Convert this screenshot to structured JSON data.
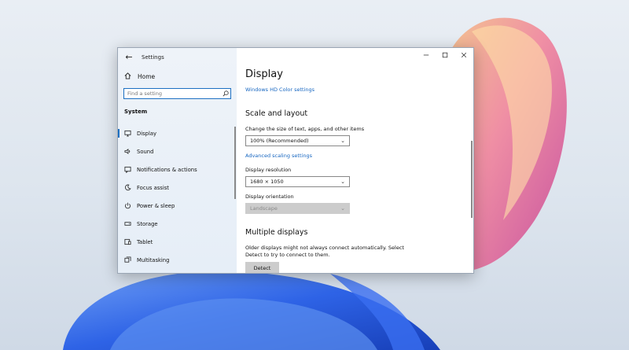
{
  "window": {
    "title": "Settings"
  },
  "sidebar": {
    "home_label": "Home",
    "search_placeholder": "Find a setting",
    "section_title": "System",
    "items": [
      {
        "label": "Display",
        "icon": "monitor-icon",
        "active": true
      },
      {
        "label": "Sound",
        "icon": "speaker-icon"
      },
      {
        "label": "Notifications & actions",
        "icon": "notifications-icon"
      },
      {
        "label": "Focus assist",
        "icon": "moon-icon"
      },
      {
        "label": "Power & sleep",
        "icon": "power-icon"
      },
      {
        "label": "Storage",
        "icon": "storage-icon"
      },
      {
        "label": "Tablet",
        "icon": "tablet-icon"
      },
      {
        "label": "Multitasking",
        "icon": "multitasking-icon"
      }
    ]
  },
  "main": {
    "title": "Display",
    "hd_color_link": "Windows HD Color settings",
    "scale_heading": "Scale and layout",
    "scale_label": "Change the size of text, apps, and other items",
    "scale_value": "100% (Recommended)",
    "advanced_link": "Advanced scaling settings",
    "resolution_label": "Display resolution",
    "resolution_value": "1680 × 1050",
    "orientation_label": "Display orientation",
    "orientation_value": "Landscape",
    "multiple_heading": "Multiple displays",
    "multiple_text": "Older displays might not always connect automatically. Select Detect to try to connect to them.",
    "detect_button": "Detect"
  },
  "colors": {
    "accent": "#1d70c2",
    "link": "#1565c0",
    "disabled_bg": "#cccccc"
  }
}
